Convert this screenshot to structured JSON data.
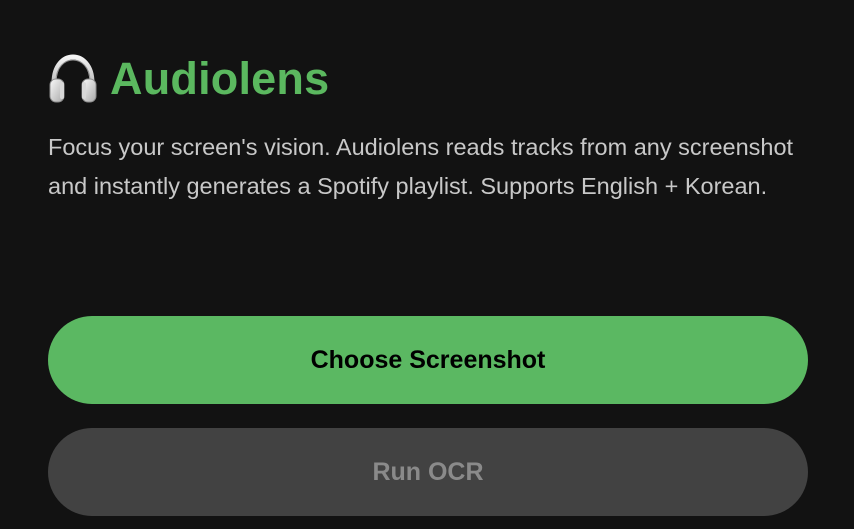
{
  "app": {
    "icon": "headphones-icon",
    "title": "Audiolens",
    "description": "Focus your screen's vision. Audiolens reads tracks from any screenshot and instantly generates a Spotify playlist. Supports English + Korean."
  },
  "actions": {
    "choose_label": "Choose Screenshot",
    "run_ocr_label": "Run OCR"
  },
  "colors": {
    "background": "#121212",
    "accent": "#5bb85f",
    "disabled_button": "#424242",
    "disabled_text": "#8a8a8a",
    "description_text": "#c8c8c8"
  }
}
